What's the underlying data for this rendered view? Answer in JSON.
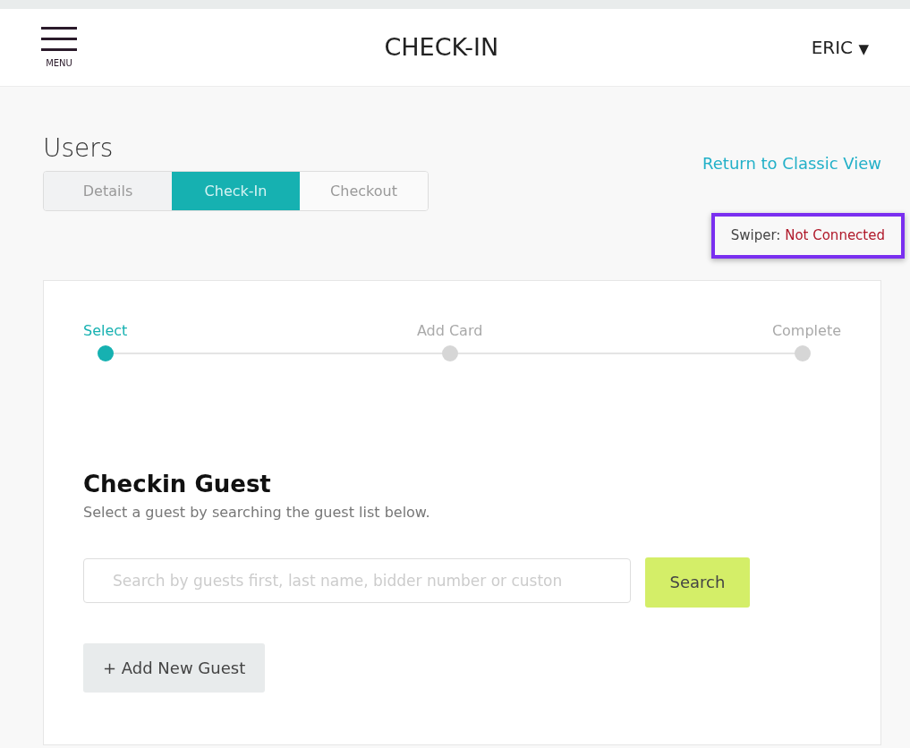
{
  "header": {
    "menu_label": "MENU",
    "title": "CHECK-IN",
    "user": "ERIC",
    "user_caret": "▼"
  },
  "section_title": "Users",
  "tabs": [
    {
      "label": "Details",
      "selected": false
    },
    {
      "label": "Check-In",
      "selected": true
    },
    {
      "label": "Checkout",
      "selected": false
    }
  ],
  "classic_link": "Return to Classic View",
  "swiper": {
    "label": "Swiper:",
    "value": "Not Connected",
    "connected": false,
    "highlighted": true
  },
  "steps": [
    {
      "label": "Select",
      "selected": true
    },
    {
      "label": "Add Card",
      "selected": false
    },
    {
      "label": "Complete",
      "selected": false
    }
  ],
  "form": {
    "title": "Checkin Guest",
    "subtitle": "Select a guest by searching the guest list below.",
    "search": {
      "placeholder": "Search by guests first, last name, bidder number or custon"
    },
    "search_button": "Search",
    "add_button": "+ Add New Guest"
  }
}
